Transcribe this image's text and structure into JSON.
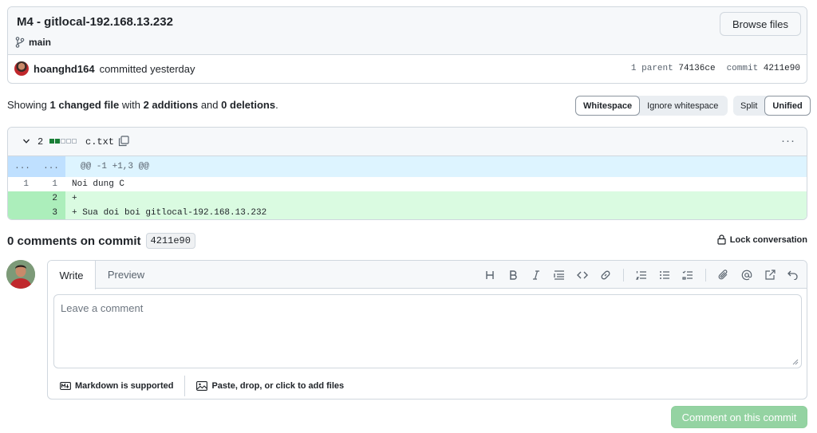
{
  "commit": {
    "title": "M4 - gitlocal-192.168.13.232",
    "branch": "main",
    "browse_files_label": "Browse files",
    "author": "hoanghd164",
    "committed_text": "committed yesterday",
    "parent_label": "1 parent",
    "parent_sha": "74136ce",
    "commit_label": "commit",
    "commit_sha": "4211e90"
  },
  "summary": {
    "showing": "Showing",
    "changed": "1 changed file",
    "with": "with",
    "additions": "2 additions",
    "and": "and",
    "deletions": "0 deletions",
    "period": "."
  },
  "whitespace_toggle": {
    "whitespace": "Whitespace",
    "ignore": "Ignore whitespace"
  },
  "view_toggle": {
    "split": "Split",
    "unified": "Unified"
  },
  "diff": {
    "count": "2",
    "bars": [
      "add",
      "add",
      "neutral",
      "neutral",
      "neutral"
    ],
    "filename": "c.txt",
    "kebab": "···",
    "hunk_left": "...",
    "hunk_right": "...",
    "hunk_header": "@@ -1 +1,3 @@",
    "lines": [
      {
        "type": "context",
        "old": "1",
        "new": "1",
        "text": "Noi dung C"
      },
      {
        "type": "add",
        "old": "",
        "new": "2",
        "text": "+"
      },
      {
        "type": "add",
        "old": "",
        "new": "3",
        "text": "+ Sua doi boi gitlocal-192.168.13.232"
      }
    ]
  },
  "comments": {
    "heading": "0 comments on commit",
    "sha": "4211e90",
    "lock_label": "Lock conversation"
  },
  "editor": {
    "tab_write": "Write",
    "tab_preview": "Preview",
    "toolbar_icons": [
      "heading-icon",
      "bold-icon",
      "italic-icon",
      "quote-icon",
      "code-icon",
      "link-icon",
      "ordered-list-icon",
      "unordered-list-icon",
      "task-list-icon",
      "attach-icon",
      "mention-icon",
      "reference-icon",
      "undo-icon"
    ],
    "placeholder": "Leave a comment",
    "markdown_label": "Markdown is supported",
    "files_label": "Paste, drop, or click to add files",
    "submit_label": "Comment on this commit"
  },
  "colors": {
    "accent_green": "#1a7f37",
    "add_bg": "#dafbe1",
    "hunk_bg": "#ddf4ff",
    "submit_disabled": "#94d3a2"
  }
}
